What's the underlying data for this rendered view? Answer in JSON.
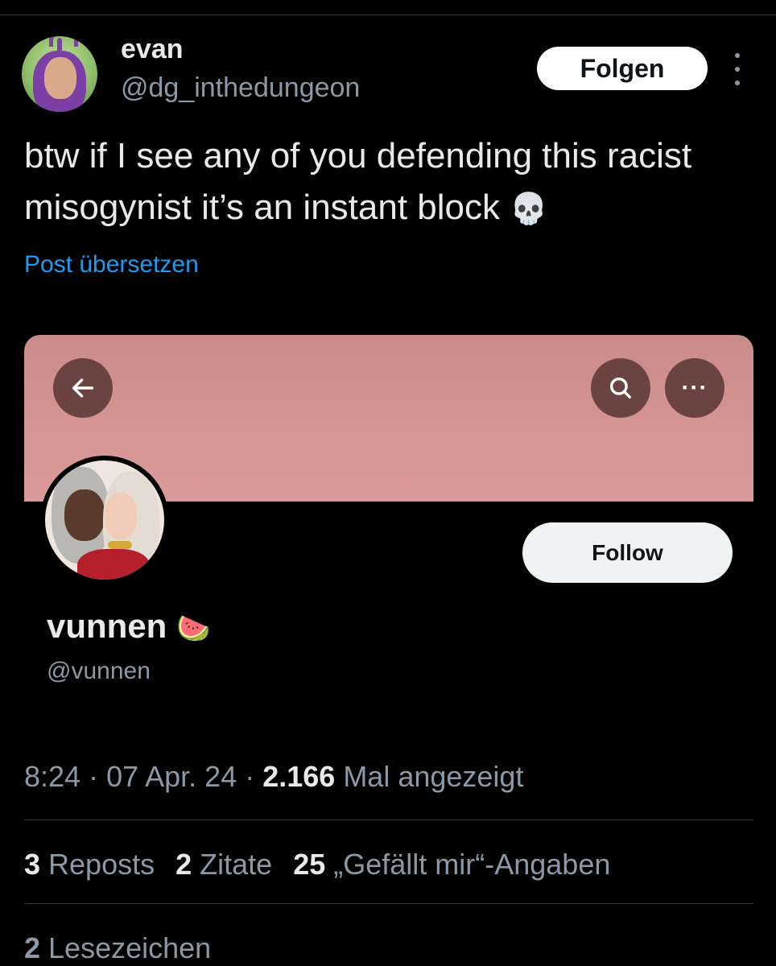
{
  "author": {
    "name": "evan",
    "handle": "@dg_inthedungeon",
    "follow_label": "Folgen"
  },
  "tweet": {
    "text": "btw if I see any of you defending this racist misogynist it’s an instant block",
    "emoji": "💀",
    "translate_label": "Post übersetzen"
  },
  "embedded_profile": {
    "name": "vunnen",
    "emoji": "🍉",
    "handle": "@vunnen",
    "follow_label": "Follow",
    "back_icon": "←",
    "dots_icon": "···"
  },
  "meta": {
    "time": "8:24",
    "sep1": " · ",
    "date": "07 Apr. 24",
    "sep2": " · ",
    "views_count": "2.166",
    "views_label": " Mal angezeigt"
  },
  "stats": {
    "reposts_count": "3",
    "reposts_label": " Reposts",
    "quotes_count": "2",
    "quotes_label": " Zitate",
    "likes_count": "25",
    "likes_label": " „Gefällt mir“-Angaben",
    "bookmarks_count": "2",
    "bookmarks_label": " Lesezeichen"
  },
  "colors": {
    "link": "#1d9bf0",
    "muted": "#8b98a5",
    "banner": "#d69595"
  }
}
